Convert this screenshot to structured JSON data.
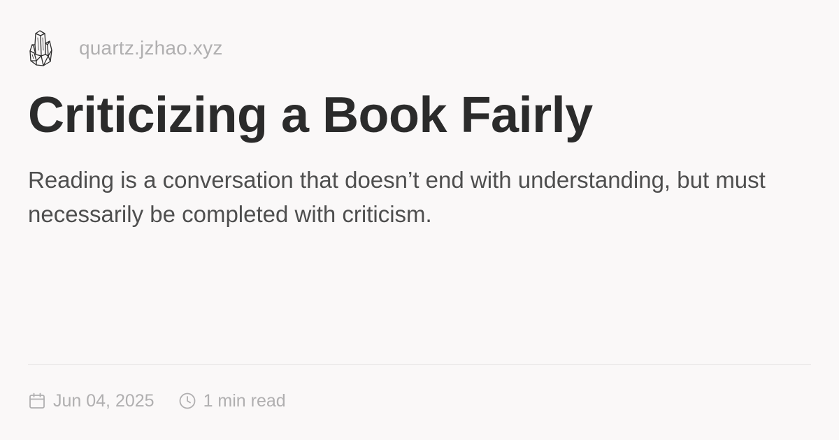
{
  "site": {
    "logo_icon": "crystal-icon",
    "url": "quartz.jzhao.xyz"
  },
  "article": {
    "title": "Criticizing a Book Fairly",
    "description": "Reading is a conversation that doesn’t end with understanding, but must necessarily be completed with criticism."
  },
  "meta": {
    "date_icon": "calendar-icon",
    "date": "Jun 04, 2025",
    "reading_time_icon": "clock-icon",
    "reading_time": "1 min read"
  },
  "colors": {
    "background": "#faf8f8",
    "title": "#2b2b2b",
    "description": "#4e4e4e",
    "muted": "#b0afb0",
    "divider": "#e6e4e4"
  }
}
